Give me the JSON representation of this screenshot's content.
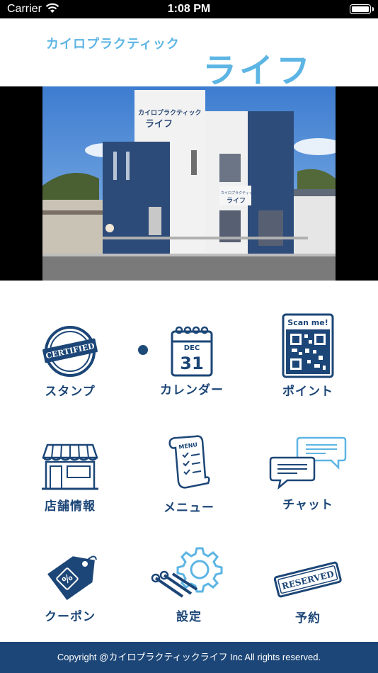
{
  "status_bar": {
    "carrier": "Carrier",
    "time": "1:08 PM"
  },
  "header": {
    "subtitle": "カイロプラクティック",
    "title": "ライフ"
  },
  "banner": {
    "sign_top": "カイロプラクティック",
    "sign_name": "ライフ"
  },
  "menu": {
    "stamp": "スタンプ",
    "stamp_badge": "CERTIFIED",
    "calendar": "カレンダー",
    "calendar_month": "DEC",
    "calendar_day": "31",
    "point": "ポイント",
    "point_scan": "Scan me!",
    "shop": "店舗情報",
    "menu": "メニュー",
    "menu_sign": "MENU",
    "chat": "チャット",
    "coupon": "クーポン",
    "coupon_symbol": "%",
    "settings": "設定",
    "reserve": "予約",
    "reserve_stamp": "RESERVED"
  },
  "footer": {
    "copyright": "Copyright @カイロプラクティックライフ Inc All rights reserved."
  },
  "colors": {
    "accent": "#5db5e4",
    "brand": "#1c4677"
  }
}
